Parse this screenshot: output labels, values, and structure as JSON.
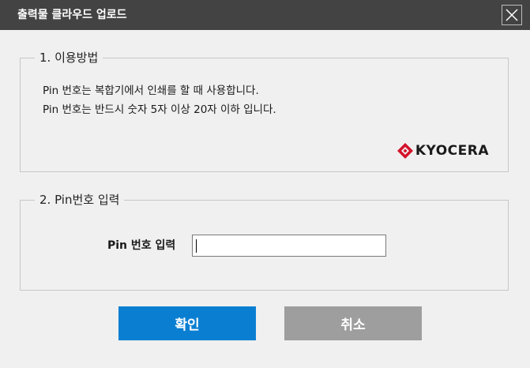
{
  "window": {
    "title": "출력물 클라우드 업로드"
  },
  "usage": {
    "legend": "1. 이용방법",
    "lines": [
      "Pin 번호는 복합기에서 인쇄를 할 때 사용합니다.",
      "Pin 번호는 반드시 숫자 5자 이상 20자 이하 입니다."
    ],
    "logo_text": "KYOCERA"
  },
  "pin_section": {
    "legend": "2. Pin번호 입력",
    "label": "Pin 번호 입력",
    "value": ""
  },
  "buttons": {
    "ok": "확인",
    "cancel": "취소"
  },
  "colors": {
    "titlebar": "#434343",
    "ok_button": "#0a7fd2",
    "cancel_button": "#9e9e9e",
    "logo_mark": "#d4122a"
  },
  "icons": {
    "close": "close-icon",
    "logo": "kyocera-logo-mark"
  }
}
